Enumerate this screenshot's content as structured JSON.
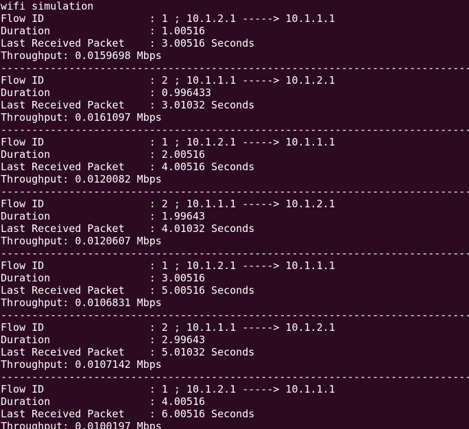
{
  "terminal": {
    "title_line": "wifi simulation",
    "separator": "------------------------------------------------------------------------------------------------------",
    "flows": [
      {
        "flow_id": "Flow ID                 : 1 ; 10.1.2.1 -----> 10.1.1.1",
        "duration": "Duration                : 1.00516",
        "last_received": "Last Received Packet    : 3.00516 Seconds",
        "throughput": "Throughput: 0.0159698 Mbps"
      },
      {
        "flow_id": "Flow ID                 : 2 ; 10.1.1.1 -----> 10.1.2.1",
        "duration": "Duration                : 0.996433",
        "last_received": "Last Received Packet    : 3.01032 Seconds",
        "throughput": "Throughput: 0.0161097 Mbps"
      },
      {
        "flow_id": "Flow ID                 : 1 ; 10.1.2.1 -----> 10.1.1.1",
        "duration": "Duration                : 2.00516",
        "last_received": "Last Received Packet    : 4.00516 Seconds",
        "throughput": "Throughput: 0.0120082 Mbps"
      },
      {
        "flow_id": "Flow ID                 : 2 ; 10.1.1.1 -----> 10.1.2.1",
        "duration": "Duration                : 1.99643",
        "last_received": "Last Received Packet    : 4.01032 Seconds",
        "throughput": "Throughput: 0.0120607 Mbps"
      },
      {
        "flow_id": "Flow ID                 : 1 ; 10.1.2.1 -----> 10.1.1.1",
        "duration": "Duration                : 3.00516",
        "last_received": "Last Received Packet    : 5.00516 Seconds",
        "throughput": "Throughput: 0.0106831 Mbps"
      },
      {
        "flow_id": "Flow ID                 : 2 ; 10.1.1.1 -----> 10.1.2.1",
        "duration": "Duration                : 2.99643",
        "last_received": "Last Received Packet    : 5.01032 Seconds",
        "throughput": "Throughput: 0.0107142 Mbps"
      },
      {
        "flow_id": "Flow ID                 : 1 ; 10.1.2.1 -----> 10.1.1.1",
        "duration": "Duration                : 4.00516",
        "last_received": "Last Received Packet    : 6.00516 Seconds",
        "throughput": "Throughput: 0.0100197 Mbps"
      }
    ],
    "colors": {
      "background": "#2c0a22",
      "text": "#ffffff"
    }
  }
}
